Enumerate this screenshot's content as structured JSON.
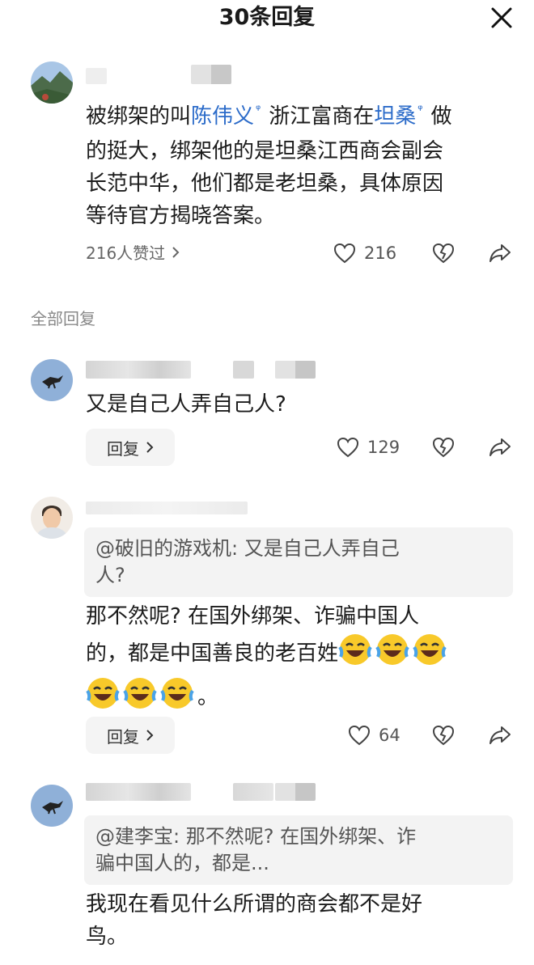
{
  "header": {
    "title": "30条回复",
    "close_icon": "close-icon"
  },
  "post": {
    "text_before_link1": "被绑架的叫",
    "link1": "陈伟义",
    "text_between": "浙江富商在",
    "link2": "坦桑",
    "line1_end": "做",
    "line2": "的挺大，绑架他的是坦桑江西商会副会",
    "line3": "长范中华，他们都是老坦桑，具体原因",
    "line4": "等待官方揭晓答案。",
    "likes_summary": "216人赞过",
    "like_count": "216"
  },
  "section_label": "全部回复",
  "comments": [
    {
      "text": "又是自己人弄自己人?",
      "reply_label": "回复",
      "like_count": "129"
    },
    {
      "quote_line1": "@破旧的游戏机:  又是自己人弄自己",
      "quote_line2": "人?",
      "line1": "那不然呢? 在国外绑架、诈骗中国人",
      "line2": "的，都是中国善良的老百姓",
      "line3_end": "。",
      "reply_label": "回复",
      "like_count": "64"
    },
    {
      "quote_line1": "@建李宝:  那不然呢? 在国外绑架、诈",
      "quote_line2": "骗中国人的，都是...",
      "line1": "我现在看见什么所谓的商会都不是好",
      "line2": "鸟。"
    }
  ],
  "colors": {
    "link": "#2b6bc9",
    "text": "#1c1c1c",
    "muted": "#666666",
    "quote_bg": "#f3f3f3"
  }
}
